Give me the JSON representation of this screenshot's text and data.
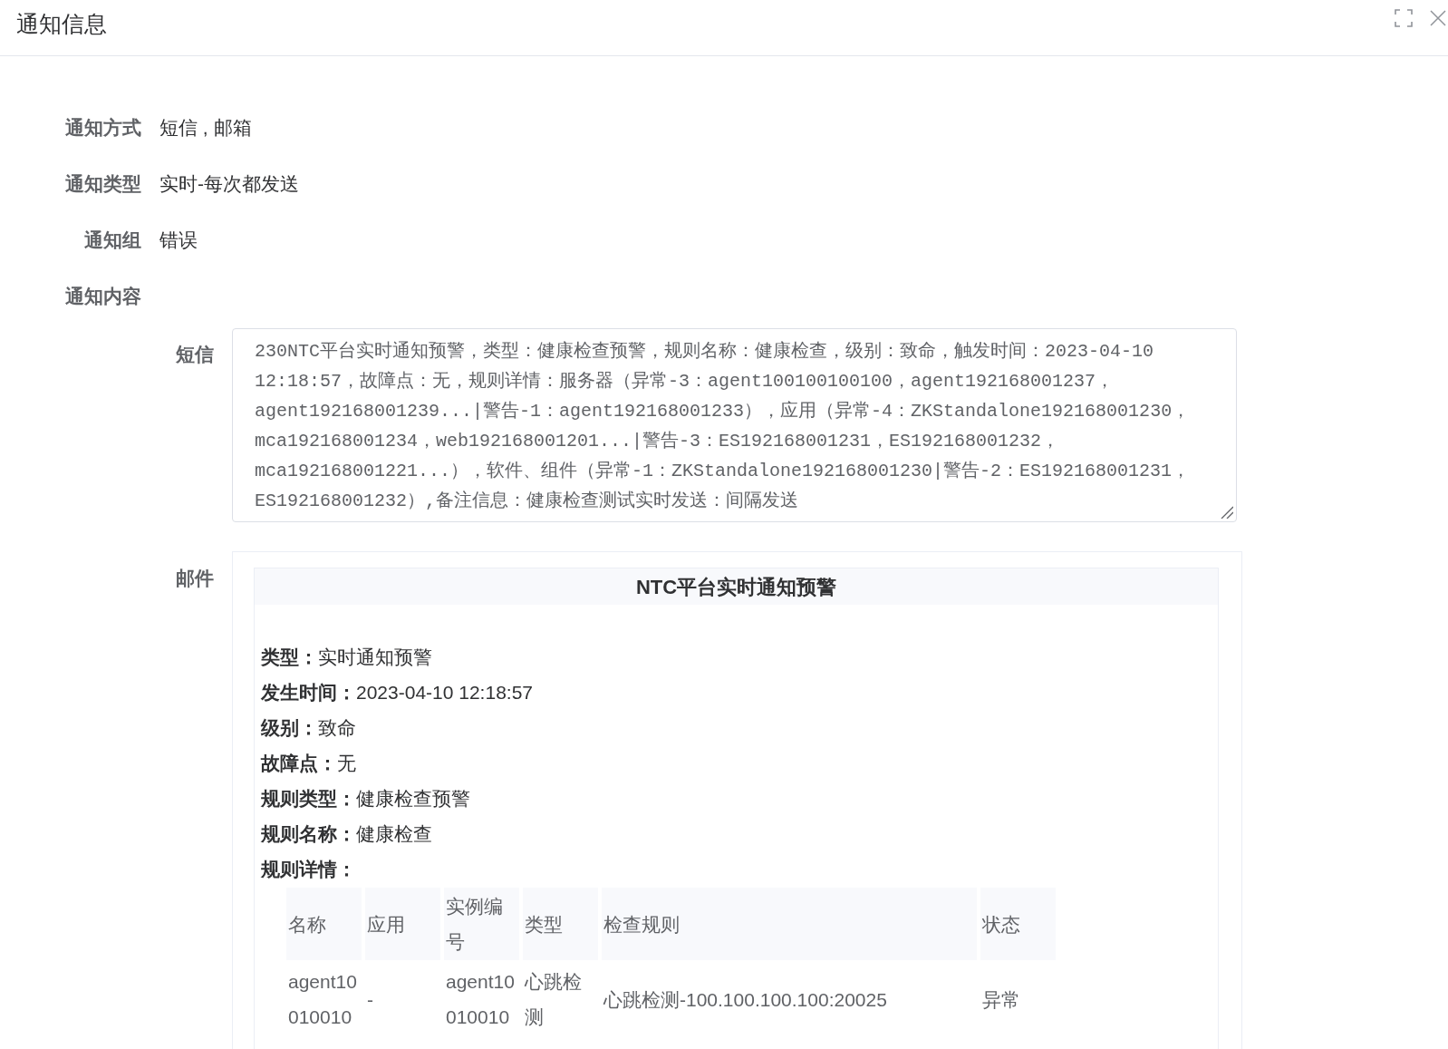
{
  "dialog": {
    "title": "通知信息"
  },
  "fields": [
    {
      "label": "通知方式",
      "value": "短信 , 邮箱"
    },
    {
      "label": "通知类型",
      "value": "实时-每次都发送"
    },
    {
      "label": "通知组",
      "value": "错误"
    }
  ],
  "content": {
    "label": "通知内容",
    "sms": {
      "label": "短信",
      "text": "230NTC平台实时通知预警，类型：健康检查预警，规则名称：健康检查，级别：致命，触发时间：2023-04-10 12:18:57，故障点：无，规则详情：服务器（异常-3：agent100100100100，agent192168001237，agent192168001239...|警告-1：agent192168001233），应用（异常-4：ZKStandalone192168001230，mca192168001234，web192168001201...|警告-3：ES192168001231，ES192168001232，mca192168001221...），软件、组件（异常-1：ZKStandalone192168001230|警告-2：ES192168001231，ES192168001232）,备注信息：健康检查测试实时发送：间隔发送"
    },
    "email": {
      "label": "邮件",
      "title": "NTC平台实时通知预警",
      "details": [
        {
          "label": "类型：",
          "value": "实时通知预警"
        },
        {
          "label": "发生时间：",
          "value": "2023-04-10 12:18:57"
        },
        {
          "label": "级别：",
          "value": "致命"
        },
        {
          "label": "故障点：",
          "value": "无"
        },
        {
          "label": "规则类型：",
          "value": "健康检查预警"
        },
        {
          "label": "规则名称：",
          "value": "健康检查"
        },
        {
          "label": "规则详情："
        }
      ],
      "table": {
        "columns": [
          "名称",
          "应用",
          "实例编号",
          "类型",
          "检查规则",
          "状态"
        ],
        "rows": [
          [
            "agent10010010",
            "-",
            "agent10010010",
            "心跳检测",
            "心跳检测-100.100.100.100:20025",
            "异常"
          ]
        ]
      }
    }
  }
}
